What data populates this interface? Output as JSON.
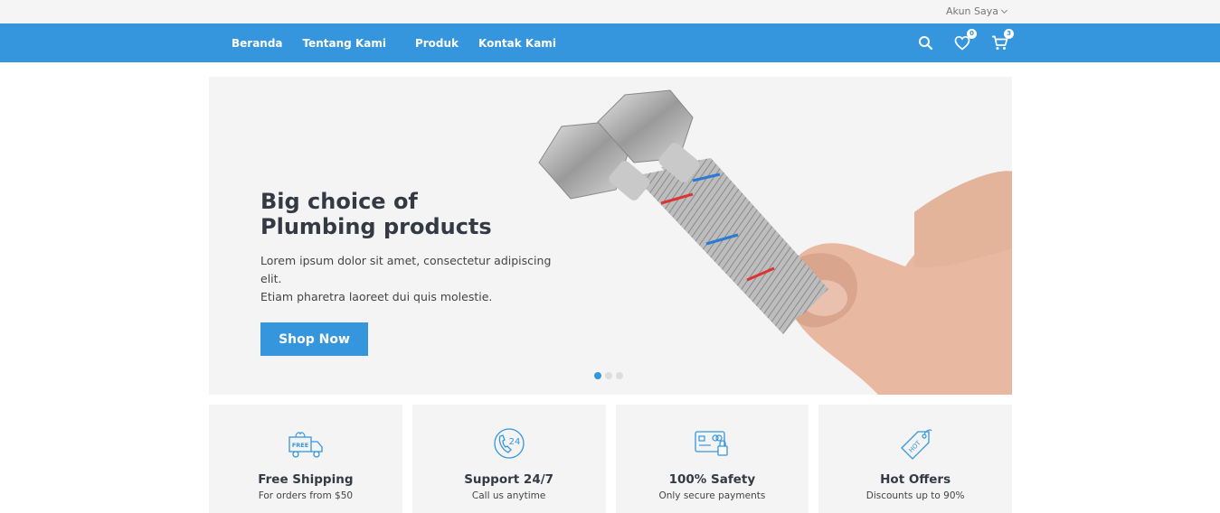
{
  "topbar": {
    "account_label": "Akun Saya"
  },
  "nav": {
    "items": [
      {
        "label": "Beranda"
      },
      {
        "label": "Tentang Kami"
      },
      {
        "label": "Produk"
      },
      {
        "label": "Kontak Kami"
      }
    ],
    "wishlist_count": "0",
    "cart_count": "3"
  },
  "hero": {
    "title_line1": "Big choice of",
    "title_line2": "Plumbing products",
    "desc_line1": "Lorem ipsum dolor sit amet, consectetur adipiscing elit.",
    "desc_line2": "Etiam pharetra laoreet dui quis molestie.",
    "button_label": "Shop Now",
    "slides_total": 3,
    "active_slide": 1
  },
  "features": [
    {
      "title": "Free Shipping",
      "subtitle": "For orders from $50",
      "icon": "free-truck-icon"
    },
    {
      "title": "Support 24/7",
      "subtitle": "Call us anytime",
      "icon": "phone-24-icon"
    },
    {
      "title": "100% Safety",
      "subtitle": "Only secure payments",
      "icon": "secure-card-icon"
    },
    {
      "title": "Hot Offers",
      "subtitle": "Discounts up to 90%",
      "icon": "hot-tag-icon"
    }
  ],
  "colors": {
    "accent": "#3596dd",
    "panel": "#f4f4f4",
    "topbar": "#f5f5f5",
    "heading": "#333a44"
  }
}
